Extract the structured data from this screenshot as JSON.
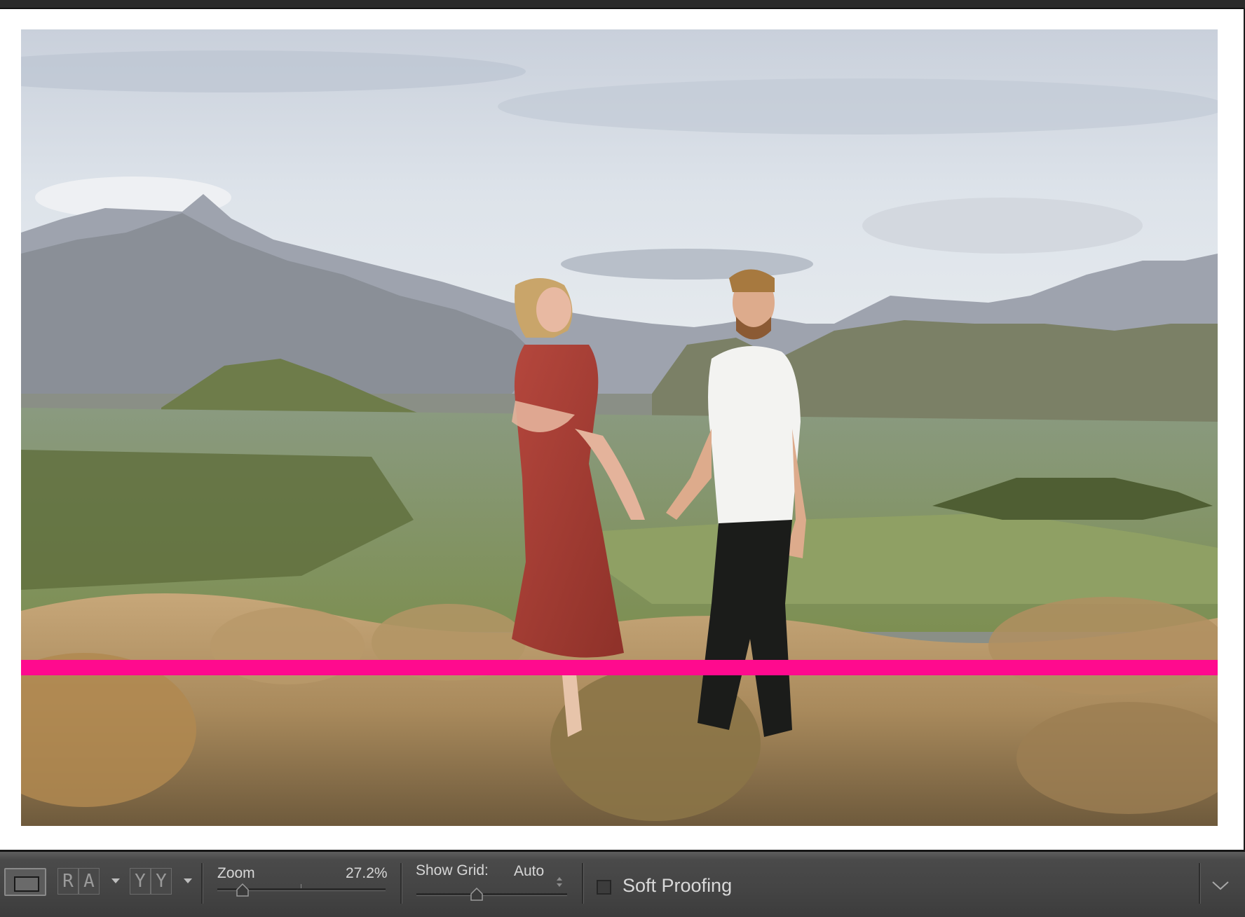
{
  "photo": {
    "subject": "photo",
    "overlay_color": "#ff0a8e"
  },
  "toolbar": {
    "loupe_view_icon": "loupe-view-icon",
    "before_after_glyphs": [
      "R",
      "A"
    ],
    "compare_glyphs": [
      "Y",
      "Y"
    ],
    "zoom_label": "Zoom",
    "zoom_value": "27.2%",
    "zoom_level_fraction": 0.15,
    "show_grid_label": "Show Grid:",
    "show_grid_value": "Auto",
    "grid_slider_fraction": 0.4,
    "soft_proofing_label": "Soft Proofing",
    "soft_proofing_checked": false,
    "menu_icon": "chevron-down-icon"
  },
  "colors": {
    "toolbar_bg": "#454545",
    "toolbar_text": "#d6d6d6",
    "overlay": "#ff0a8e"
  }
}
